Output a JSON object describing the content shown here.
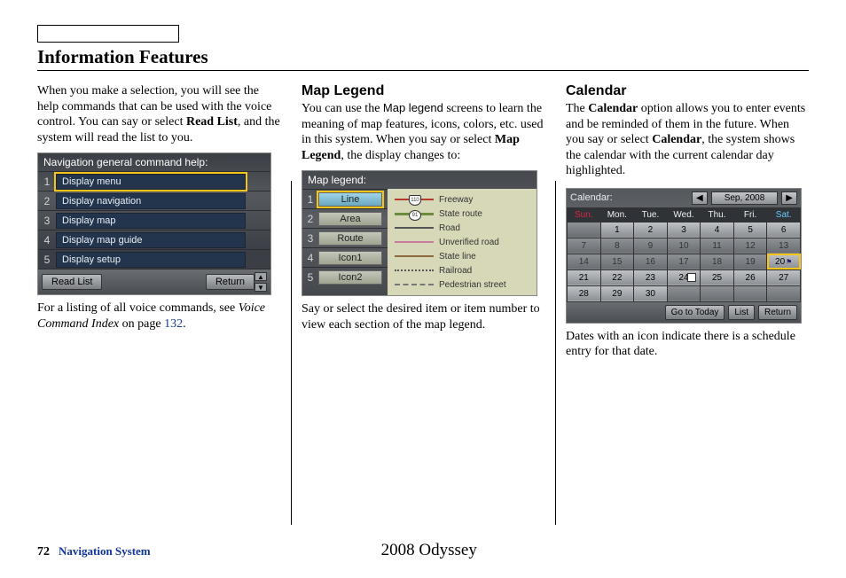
{
  "title": "Information Features",
  "col1": {
    "p1a": "When you make a selection, you will see the help commands that can be used with the voice control. You can say or select ",
    "p1b": "Read List",
    "p1c": ", and the system will read the list to you.",
    "nav": {
      "title": "Navigation general command help:",
      "items": [
        "Display menu",
        "Display navigation",
        "Display map",
        "Display map guide",
        "Display setup"
      ],
      "read_list": "Read List",
      "return": "Return"
    },
    "p2a": "For a listing of all voice commands, see ",
    "p2b": "Voice Command Index",
    "p2c": " on page ",
    "p2d": "132",
    "p2e": "."
  },
  "col2": {
    "heading": "Map Legend",
    "p1a": "You can use the ",
    "p1b": "Map legend",
    "p1c": " screens to learn the meaning of map features, icons, colors, etc. used in this system. When you say or select ",
    "p1d": "Map Legend",
    "p1e": ", the display changes to:",
    "map": {
      "title": "Map legend:",
      "tabs": [
        "Line",
        "Area",
        "Route",
        "Icon1",
        "Icon2"
      ],
      "legend": [
        "Freeway",
        "State route",
        "Road",
        "Unverified road",
        "State line",
        "Railroad",
        "Pedestrian street"
      ],
      "shield1": "110",
      "shield2": "91"
    },
    "p2": "Say or select the desired item or item number to view each section of the map legend."
  },
  "col3": {
    "heading": "Calendar",
    "p1a": "The ",
    "p1b": "Calendar",
    "p1c": " option allows you to enter events and be reminded of them in the future. When you say or select ",
    "p1d": "Calendar",
    "p1e": ", the system shows the calendar with the current calendar day highlighted.",
    "cal": {
      "label": "Calendar:",
      "month": "Sep, 2008",
      "days": [
        "Sun.",
        "Mon.",
        "Tue.",
        "Wed.",
        "Thu.",
        "Fri.",
        "Sat."
      ],
      "btn_today": "Go to Today",
      "btn_list": "List",
      "btn_return": "Return"
    },
    "p2": "Dates with an icon indicate there is a schedule entry for that date."
  },
  "footer": {
    "page": "72",
    "section": "Navigation System",
    "model": "2008  Odyssey"
  }
}
